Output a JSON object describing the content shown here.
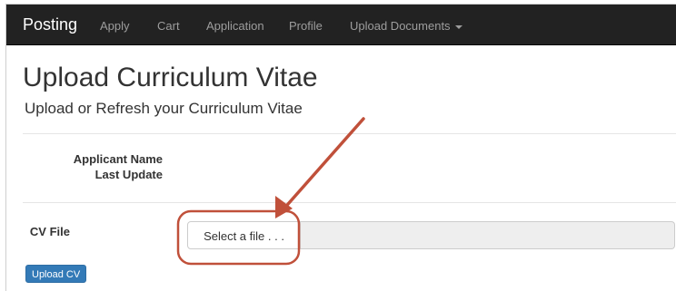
{
  "navbar": {
    "brand": "Posting",
    "items": [
      {
        "label": "Apply"
      },
      {
        "label": "Cart"
      },
      {
        "label": "Application"
      },
      {
        "label": "Profile"
      },
      {
        "label": "Upload Documents"
      }
    ]
  },
  "page": {
    "title": "Upload Curriculum Vitae",
    "subtitle": "Upload or Refresh your Curriculum Vitae"
  },
  "applicant": {
    "name_label": "Applicant Name",
    "last_update_label": "Last Update"
  },
  "cv_field": {
    "label": "CV File",
    "select_button": "Select a file . . .",
    "file_name": ""
  },
  "upload_button": "Upload CV",
  "colors": {
    "navbar_bg": "#222222",
    "annotation": "#c0503a",
    "primary_button": "#337ab7"
  },
  "icons": {
    "dropdown": "caret-down-icon",
    "annotation_arrow": "arrow-annotation",
    "annotation_highlight": "rounded-rect-highlight"
  }
}
